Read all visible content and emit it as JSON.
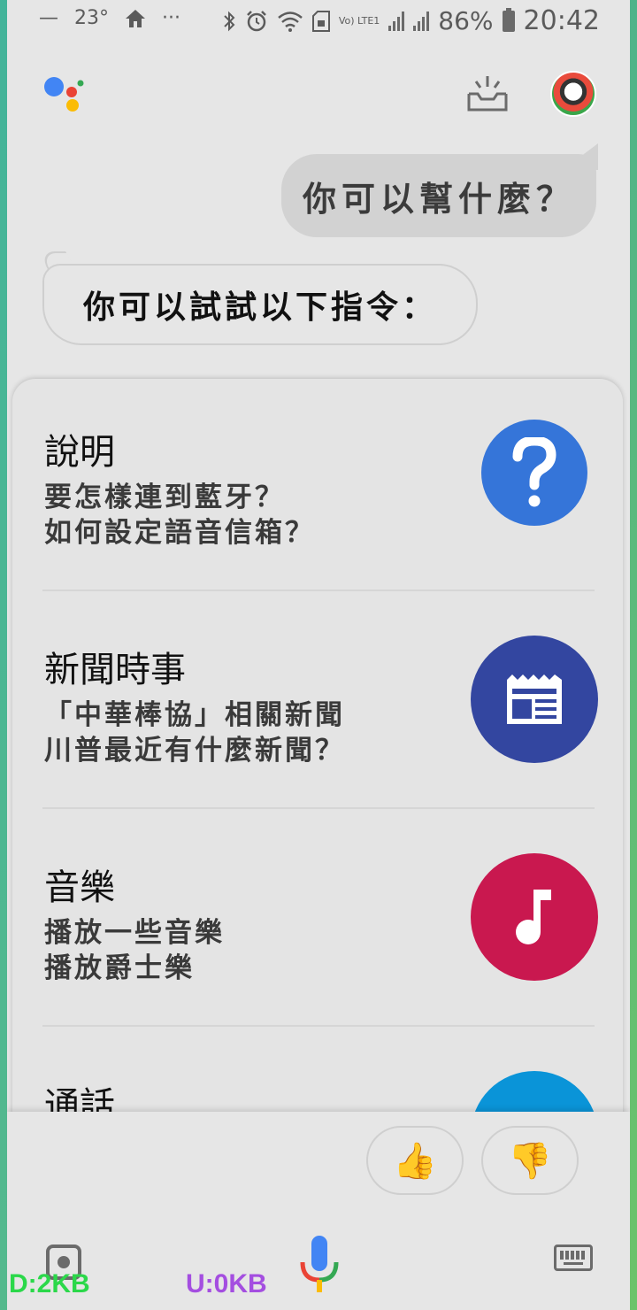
{
  "status_bar": {
    "minimize_glyph": "—",
    "temperature": "23°",
    "more_glyph": "···",
    "lte_label": "Vo) LTE1",
    "battery_percent": "86%",
    "time": "20:42"
  },
  "conversation": {
    "user_query": "你可以幫什麼？",
    "assistant_reply": "你可以試試以下指令："
  },
  "suggestions": [
    {
      "title": "說明",
      "lines": [
        "要怎樣連到藍牙？",
        "如何設定語音信箱？"
      ],
      "icon": "help-icon",
      "color": "#3575d9"
    },
    {
      "title": "新聞時事",
      "lines": [
        "「中華棒協」相關新聞",
        "川普最近有什麼新聞？"
      ],
      "icon": "newspaper-icon",
      "color": "#3346a0"
    },
    {
      "title": "音樂",
      "lines": [
        "播放一些音樂",
        "播放爵士樂"
      ],
      "icon": "music-note-icon",
      "color": "#c9184f"
    },
    {
      "title": "通話",
      "lines": [],
      "icon": "phone-icon",
      "color": "#0a94d8"
    }
  ],
  "feedback": {
    "thumbs_up": "👍",
    "thumbs_down": "👎"
  },
  "net_monitor": {
    "download": "D:2KB",
    "upload": "U:0KB"
  },
  "colors": {
    "google_blue": "#4285f4",
    "google_red": "#ea4335",
    "google_yellow": "#fbbc05",
    "google_green": "#34a853"
  }
}
